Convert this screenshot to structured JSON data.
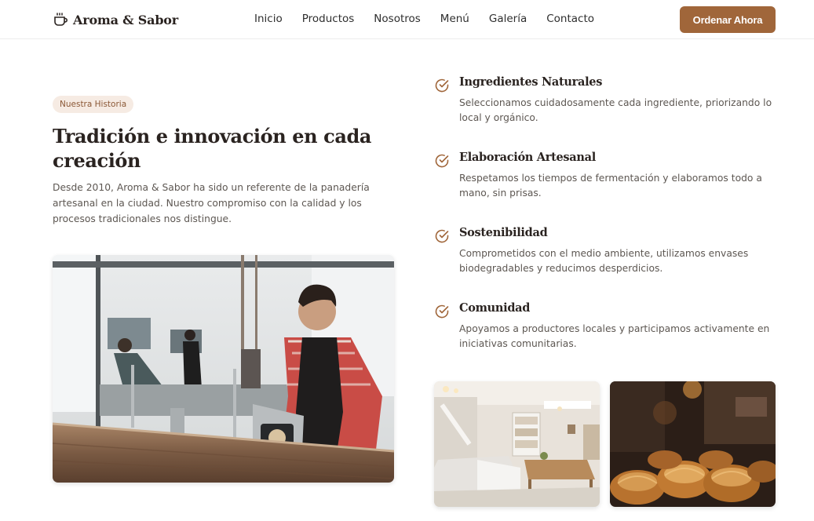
{
  "brand": {
    "name": "Aroma & Sabor",
    "icon": "coffee-cup-icon"
  },
  "nav": {
    "items": [
      "Inicio",
      "Productos",
      "Nosotros",
      "Menú",
      "Galería",
      "Contacto"
    ],
    "cta": "Ordenar Ahora"
  },
  "about": {
    "badge": "Nuestra Historia",
    "title": "Tradición e innovación en cada creación",
    "text": "Desde 2010, Aroma & Sabor ha sido un referente de la panadería artesanal en la ciudad. Nuestro compromiso con la calidad y los procesos tradicionales nos distingue."
  },
  "features": [
    {
      "icon": "check-circle-icon",
      "title": "Ingredientes Naturales",
      "text": "Seleccionamos cuidadosamente cada ingrediente, priorizando lo local y orgánico."
    },
    {
      "icon": "check-circle-icon",
      "title": "Elaboración Artesanal",
      "text": "Respetamos los tiempos de fermentación y elaboramos todo a mano, sin prisas."
    },
    {
      "icon": "check-circle-icon",
      "title": "Sostenibilidad",
      "text": "Comprometidos con el medio ambiente, utilizamos envases biodegradables y reducimos desperdicios."
    },
    {
      "icon": "check-circle-icon",
      "title": "Comunidad",
      "text": "Apoyamos a productores locales y participamos activamente en iniciativas comunitarias."
    }
  ],
  "colors": {
    "accent": "#a0663a",
    "badge_bg": "#f6ebe3",
    "text": "#2a2320",
    "muted": "#5d5752"
  }
}
